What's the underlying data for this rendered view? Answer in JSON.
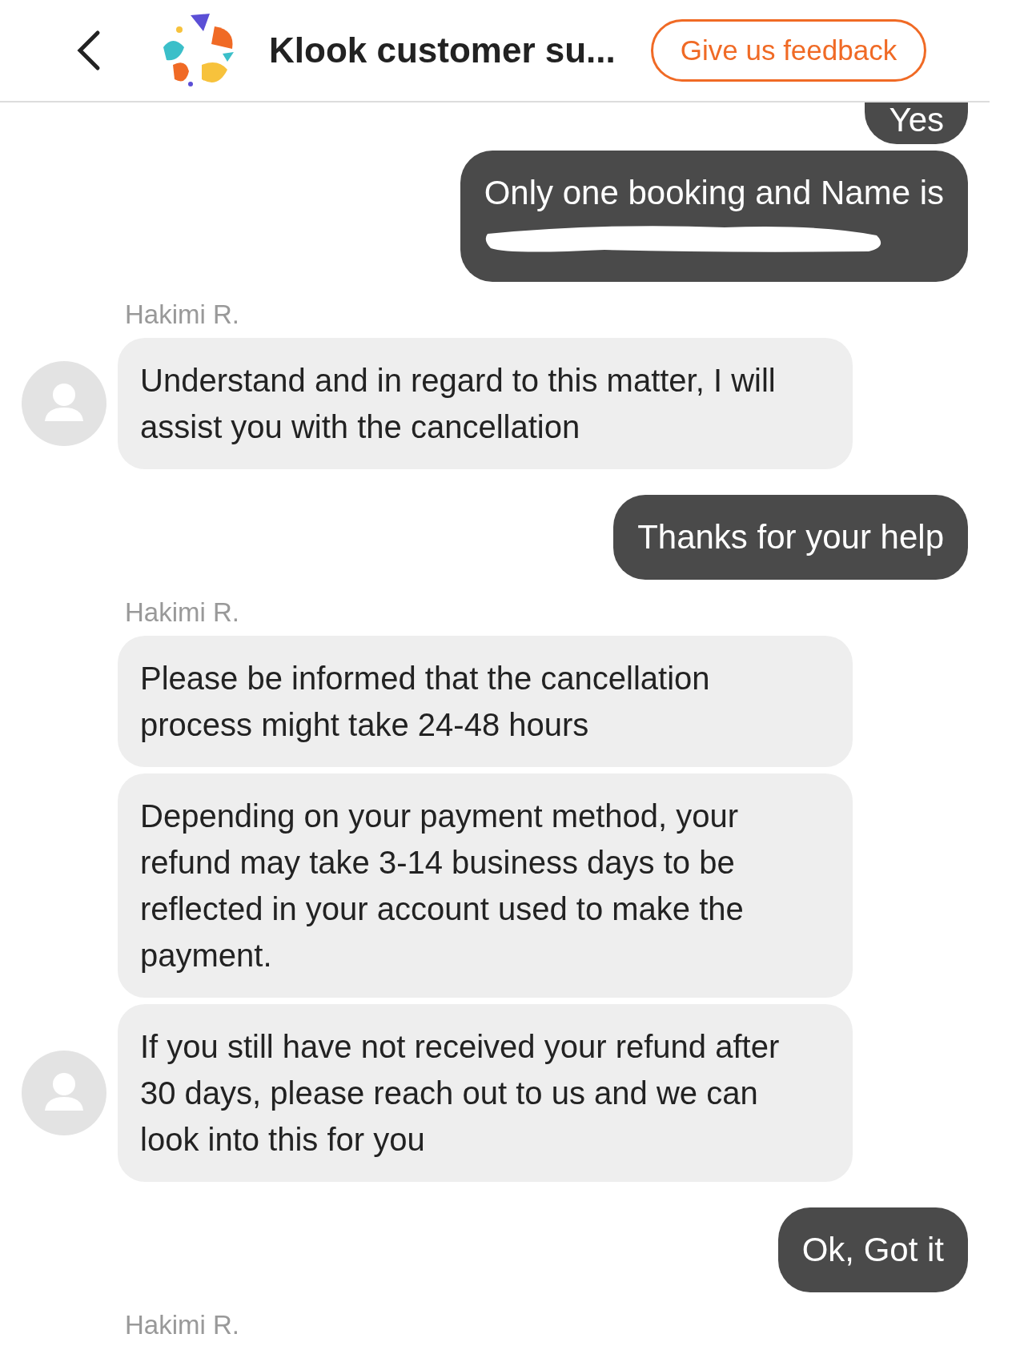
{
  "header": {
    "title": "Klook customer su...",
    "feedback_button": "Give us feedback"
  },
  "messages": [
    {
      "kind": "outgoing",
      "text": "Yes",
      "redacted": false
    },
    {
      "kind": "outgoing",
      "text": "Only one booking and Name is",
      "redacted": true
    },
    {
      "kind": "sender",
      "text": "Hakimi R."
    },
    {
      "kind": "incoming",
      "text": "Understand and in regard to this matter, I will assist you with the cancellation",
      "avatar": true
    },
    {
      "kind": "outgoing",
      "text": "Thanks for your help",
      "redacted": false
    },
    {
      "kind": "sender",
      "text": "Hakimi R."
    },
    {
      "kind": "incoming",
      "text": "Please be informed that the cancellation process might take 24-48 hours",
      "avatar": false
    },
    {
      "kind": "incoming",
      "text": "Depending on your payment method, your refund may take 3-14 business days to be reflected in your account used to make the payment.",
      "avatar": false
    },
    {
      "kind": "incoming",
      "text": "If you still have not received your refund after 30 days, please reach out to us and we can look into this for you",
      "avatar": true
    },
    {
      "kind": "outgoing",
      "text": "Ok, Got it",
      "redacted": false
    },
    {
      "kind": "sender",
      "text": "Hakimi R."
    }
  ]
}
